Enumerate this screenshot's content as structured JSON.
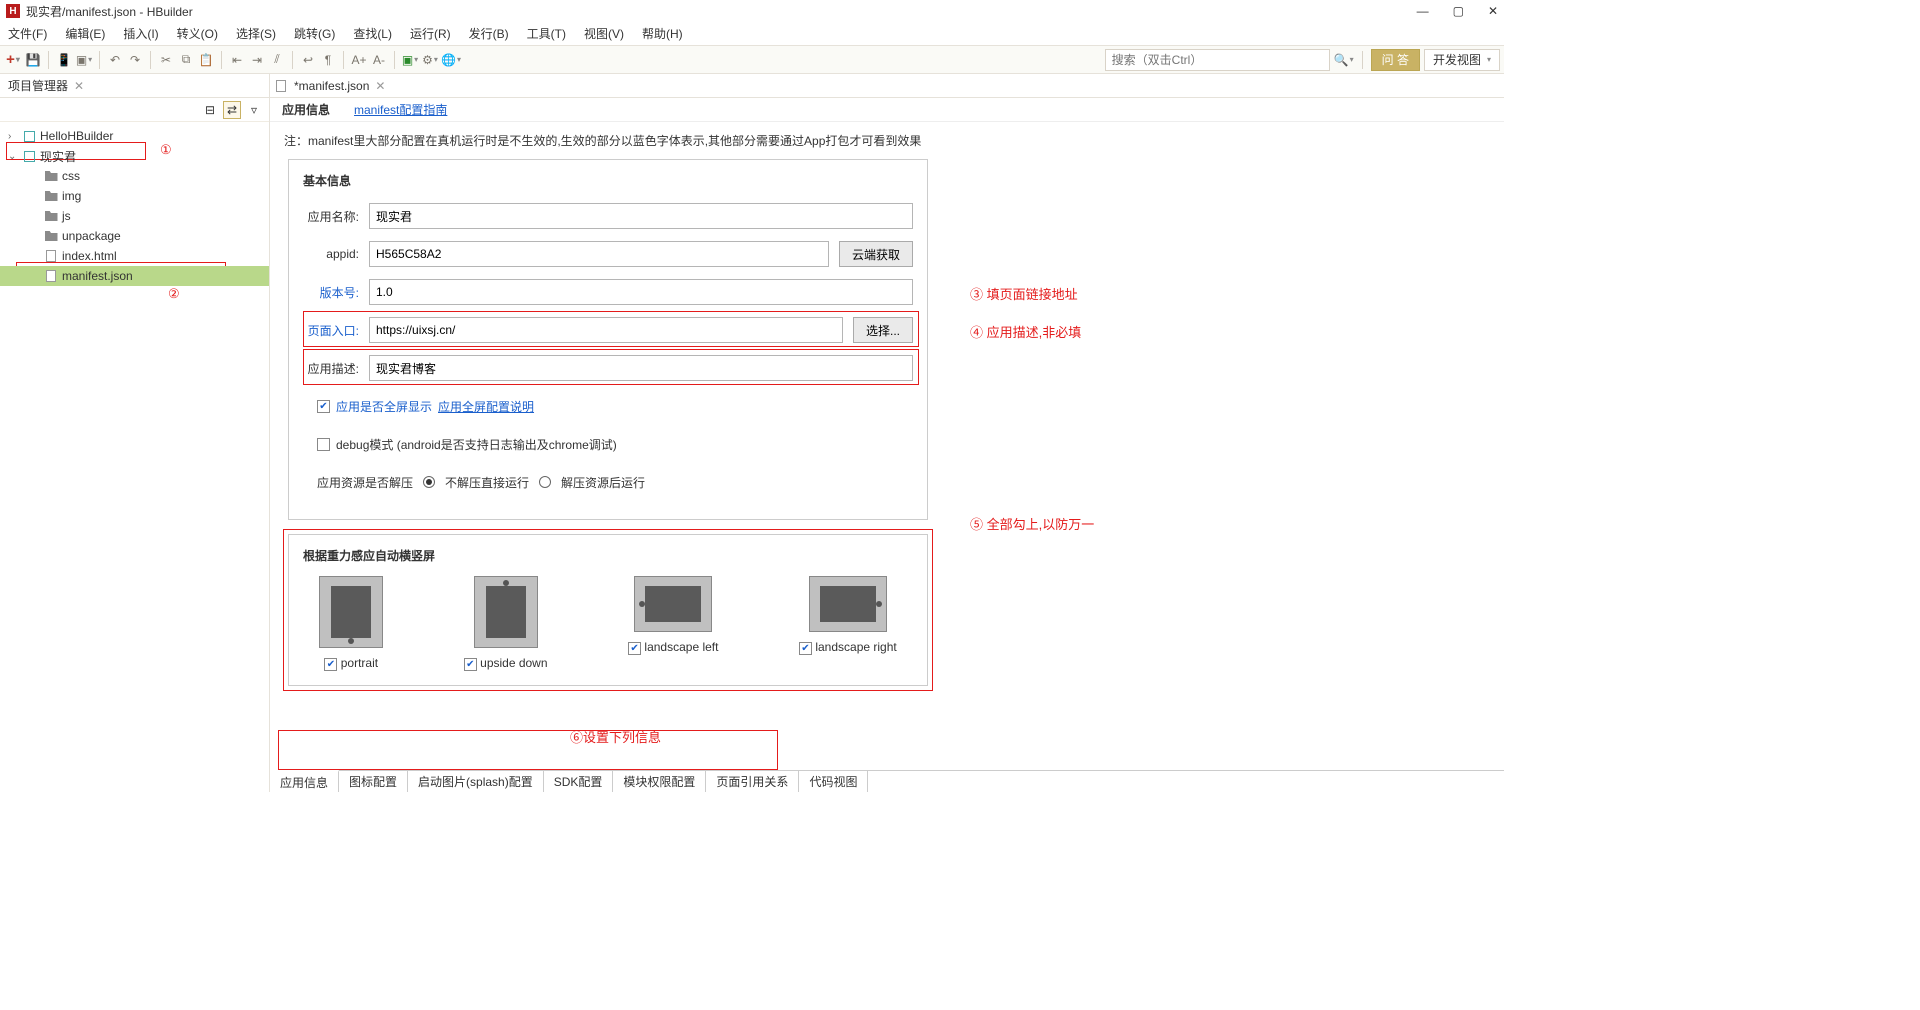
{
  "window": {
    "title": "现实君/manifest.json - HBuilder",
    "min": "—",
    "max": "▢",
    "close": "✕"
  },
  "menu": [
    "文件(F)",
    "编辑(E)",
    "插入(I)",
    "转义(O)",
    "选择(S)",
    "跳转(G)",
    "查找(L)",
    "运行(R)",
    "发行(B)",
    "工具(T)",
    "视图(V)",
    "帮助(H)"
  ],
  "toolbar": {
    "search_ph": "搜索（双击Ctrl）",
    "qa": "问 答",
    "view": "开发视图"
  },
  "sidebar": {
    "title": "项目管理器",
    "tree": [
      {
        "indent": 0,
        "chev": "›",
        "type": "prj",
        "label": "HelloHBuilder"
      },
      {
        "indent": 0,
        "chev": "⌄",
        "type": "prj",
        "label": "现实君",
        "box": 1
      },
      {
        "indent": 1,
        "chev": "",
        "type": "folder",
        "label": "css"
      },
      {
        "indent": 1,
        "chev": "",
        "type": "folder",
        "label": "img"
      },
      {
        "indent": 1,
        "chev": "",
        "type": "folder",
        "label": "js"
      },
      {
        "indent": 1,
        "chev": "",
        "type": "folder",
        "label": "unpackage"
      },
      {
        "indent": 1,
        "chev": "",
        "type": "file",
        "label": "index.html"
      },
      {
        "indent": 1,
        "chev": "",
        "type": "file",
        "label": "manifest.json",
        "sel": true,
        "box": 2
      }
    ]
  },
  "anno": {
    "a1": "①",
    "a2": "②",
    "a3": "③ 填页面链接地址",
    "a4": "④ 应用描述,非必填",
    "a5": "⑤ 全部勾上,以防万一",
    "a6": "⑥设置下列信息"
  },
  "editor": {
    "tab": "*manifest.json",
    "subhead": {
      "label": "应用信息",
      "link": "manifest配置指南"
    },
    "note": "注：manifest里大部分配置在真机运行时是不生效的,生效的部分以蓝色字体表示,其他部分需要通过App打包才可看到效果",
    "basic": {
      "legend": "基本信息",
      "name": {
        "label": "应用名称:",
        "value": "现实君"
      },
      "appid": {
        "label": "appid:",
        "value": "H565C58A2",
        "btn": "云端获取"
      },
      "ver": {
        "label": "版本号:",
        "value": "1.0"
      },
      "entry": {
        "label": "页面入口:",
        "value": "https://uixsj.cn/",
        "btn": "选择..."
      },
      "desc": {
        "label": "应用描述:",
        "value": "现实君博客"
      },
      "fullscreen": {
        "label": "应用是否全屏显示",
        "link": "应用全屏配置说明"
      },
      "debug": "debug模式 (android是否支持日志输出及chrome调试)",
      "unpack": {
        "label": "应用资源是否解压",
        "o1": "不解压直接运行",
        "o2": "解压资源后运行"
      }
    },
    "orient": {
      "legend": "根据重力感应自动横竖屏",
      "items": [
        {
          "k": "portrait",
          "l": "portrait"
        },
        {
          "k": "upside",
          "l": "upside down"
        },
        {
          "k": "lleft",
          "l": "landscape left"
        },
        {
          "k": "lright",
          "l": "landscape right"
        }
      ]
    },
    "btabs": [
      "应用信息",
      "图标配置",
      "启动图片(splash)配置",
      "SDK配置",
      "模块权限配置",
      "页面引用关系",
      "代码视图"
    ]
  }
}
